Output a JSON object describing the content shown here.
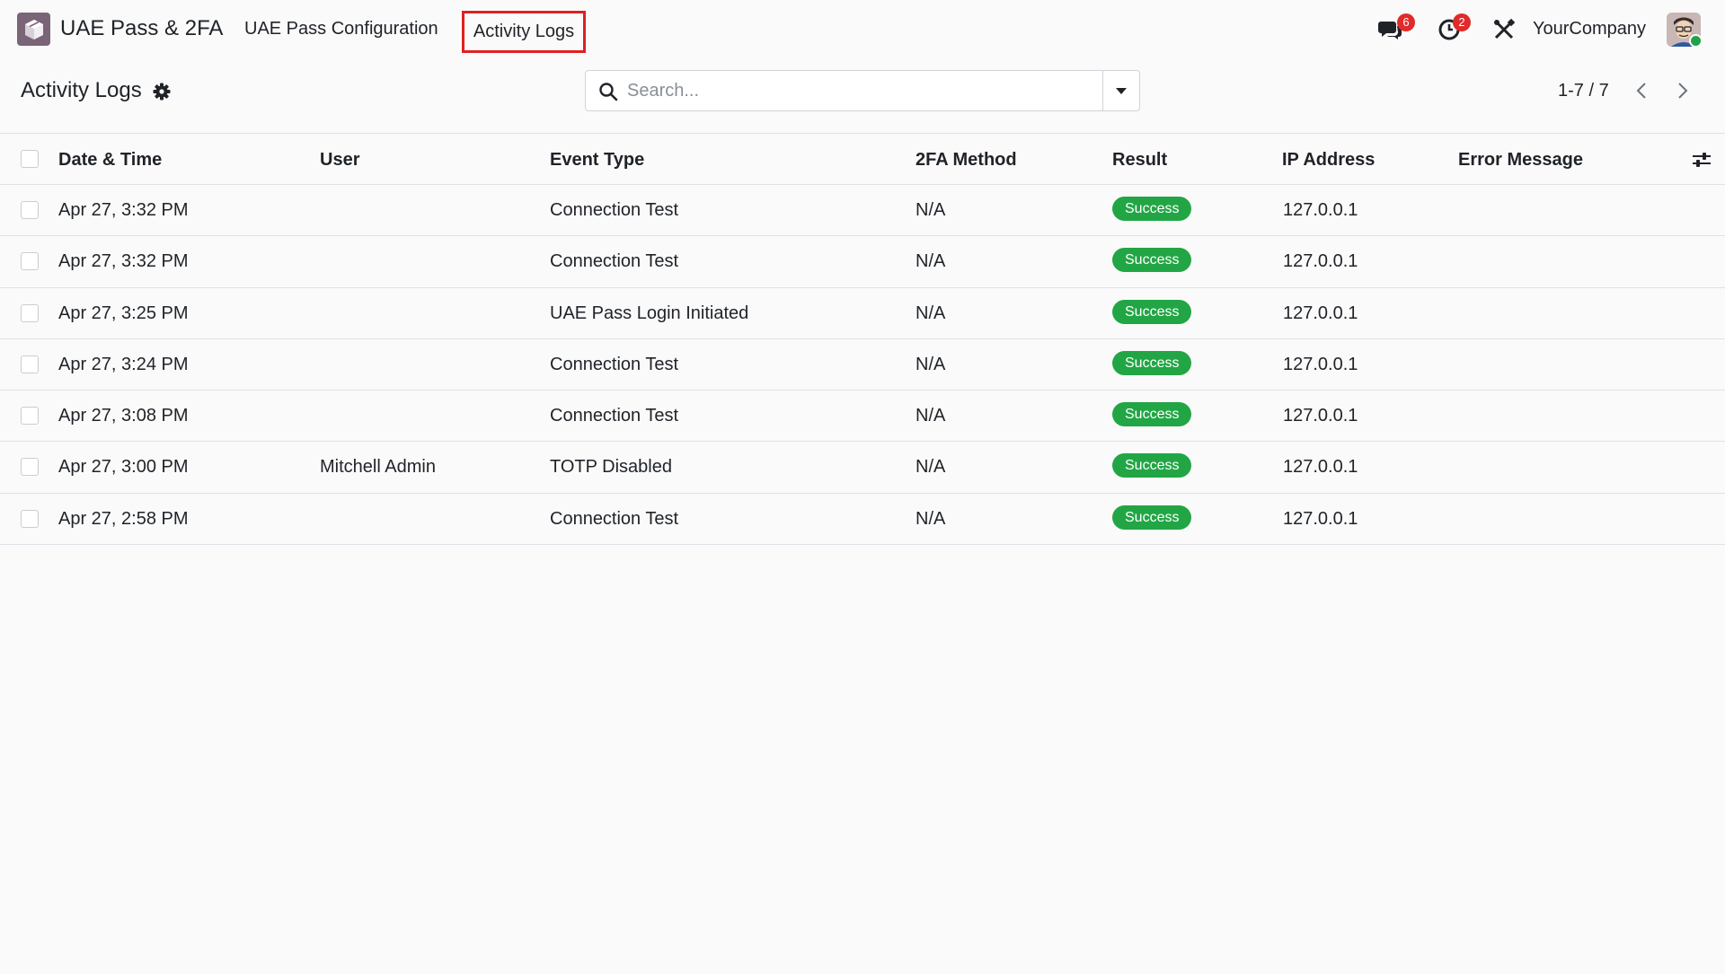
{
  "app": {
    "brand": "UAE Pass & 2FA",
    "menu": {
      "config": "UAE Pass Configuration",
      "logs": "Activity Logs"
    },
    "icon": "app-cube-icon"
  },
  "systray": {
    "messages_count": "6",
    "activities_count": "2",
    "company": "YourCompany",
    "icons": [
      "chat-icon",
      "clock-icon",
      "tools-icon",
      "avatar"
    ]
  },
  "control_panel": {
    "title": "Activity Logs",
    "search_placeholder": "Search...",
    "pager": "1-7 / 7"
  },
  "table": {
    "headers": {
      "date": "Date & Time",
      "user": "User",
      "event": "Event Type",
      "method": "2FA Method",
      "result": "Result",
      "ip": "IP Address",
      "error": "Error Message"
    },
    "rows": [
      {
        "date": "Apr 27, 3:32 PM",
        "user": "",
        "event": "Connection Test",
        "method": "N/A",
        "result": "Success",
        "ip": "127.0.0.1",
        "error": ""
      },
      {
        "date": "Apr 27, 3:32 PM",
        "user": "",
        "event": "Connection Test",
        "method": "N/A",
        "result": "Success",
        "ip": "127.0.0.1",
        "error": ""
      },
      {
        "date": "Apr 27, 3:25 PM",
        "user": "",
        "event": "UAE Pass Login Initiated",
        "method": "N/A",
        "result": "Success",
        "ip": "127.0.0.1",
        "error": ""
      },
      {
        "date": "Apr 27, 3:24 PM",
        "user": "",
        "event": "Connection Test",
        "method": "N/A",
        "result": "Success",
        "ip": "127.0.0.1",
        "error": ""
      },
      {
        "date": "Apr 27, 3:08 PM",
        "user": "",
        "event": "Connection Test",
        "method": "N/A",
        "result": "Success",
        "ip": "127.0.0.1",
        "error": ""
      },
      {
        "date": "Apr 27, 3:00 PM",
        "user": "Mitchell Admin",
        "event": "TOTP Disabled",
        "method": "N/A",
        "result": "Success",
        "ip": "127.0.0.1",
        "error": ""
      },
      {
        "date": "Apr 27, 2:58 PM",
        "user": "",
        "event": "Connection Test",
        "method": "N/A",
        "result": "Success",
        "ip": "127.0.0.1",
        "error": ""
      }
    ]
  },
  "colors": {
    "success": "#22a645",
    "badge": "#e02b2b",
    "highlight": "#e02020",
    "app_icon": "#7a6478"
  }
}
